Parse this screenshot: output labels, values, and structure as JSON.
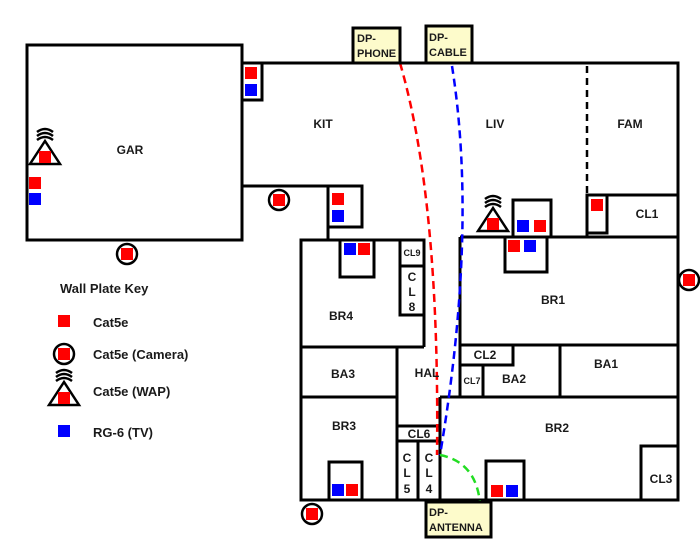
{
  "rooms": {
    "gar": "GAR",
    "kit": "KIT",
    "liv": "LIV",
    "fam": "FAM",
    "cl1": "CL1",
    "br1": "BR1",
    "br4": "BR4",
    "cl9": "CL9",
    "cl8": [
      "C",
      "L",
      "8"
    ],
    "ba3": "BA3",
    "hal": "HAL",
    "br3": "BR3",
    "cl6": "CL6",
    "cl5": [
      "C",
      "L",
      "5"
    ],
    "cl4": [
      "C",
      "L",
      "4"
    ],
    "br2": "BR2",
    "cl3": "CL3",
    "cl2": "CL2",
    "cl7": "CL7",
    "ba2": "BA2",
    "ba1": "BA1"
  },
  "demarc": {
    "phone": [
      "DP-",
      "PHONE"
    ],
    "cable": [
      "DP-",
      "CABLE"
    ],
    "antenna": [
      "DP-",
      "ANTENNA"
    ]
  },
  "key": {
    "title": "Wall Plate Key",
    "items": [
      {
        "icon": "cat5e-icon",
        "label": "Cat5e"
      },
      {
        "icon": "camera-icon",
        "label": "Cat5e (Camera)"
      },
      {
        "icon": "wap-icon",
        "label": "Cat5e (WAP)"
      },
      {
        "icon": "rg6-icon",
        "label": "RG-6 (TV)"
      }
    ]
  },
  "colors": {
    "cat5e": "#ff0000",
    "rg6": "#0000ff",
    "antenna_run": "#22dd22",
    "dp_fill": "#fdfbcb"
  }
}
